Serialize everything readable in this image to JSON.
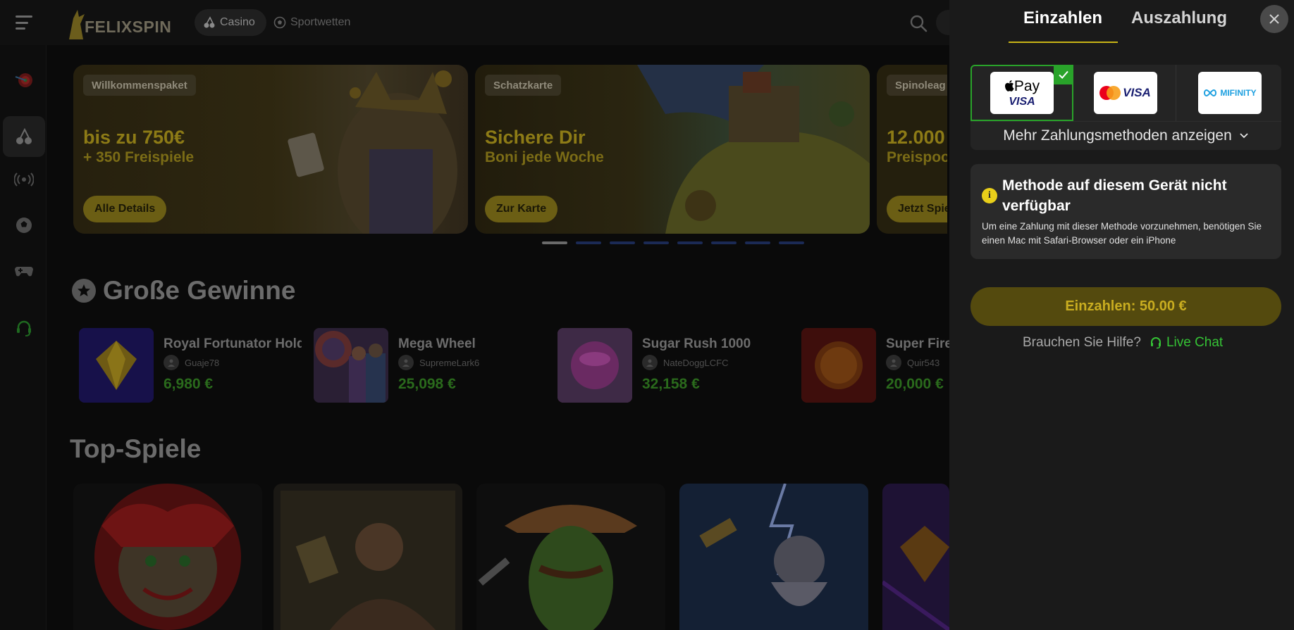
{
  "header": {
    "logo_text": "FELIXSPIN",
    "nav": {
      "casino": "Casino",
      "sports": "Sportwetten"
    }
  },
  "banners": [
    {
      "tag": "Willkommenspaket",
      "title": "bis zu 750€",
      "subtitle": "+ 350 Freispiele",
      "button": "Alle Details"
    },
    {
      "tag": "Schatzkarte",
      "title": "Sichere Dir",
      "subtitle": "Boni jede Woche",
      "button": "Zur Karte"
    },
    {
      "tag": "Spinoleag",
      "title": "12.000",
      "subtitle": "Preispoo",
      "button": "Jetzt Spie"
    }
  ],
  "carousel": {
    "count": 8,
    "active": 0
  },
  "big_wins": {
    "title": "Große Gewinne",
    "items": [
      {
        "game": "Royal Fortunator Hold",
        "user": "Guaje78",
        "amount": "6,980 €"
      },
      {
        "game": "Mega Wheel",
        "user": "SupremeLark6",
        "amount": "25,098 €"
      },
      {
        "game": "Sugar Rush 1000",
        "user": "NateDoggLCFC",
        "amount": "32,158 €"
      },
      {
        "game": "Super Fire",
        "user": "Quir543",
        "amount": "20,000 €"
      }
    ]
  },
  "top_games": {
    "title": "Top-Spiele"
  },
  "cashier": {
    "tabs": {
      "deposit": "Einzahlen",
      "payout": "Auszahlung"
    },
    "payment_methods": {
      "apple_pay": {
        "top": "Pay",
        "bottom": "VISA"
      },
      "card": {
        "label": "VISA"
      },
      "mifinity": {
        "label": "MIFINITY"
      },
      "more": "Mehr Zahlungsmethoden anzeigen"
    },
    "notice": {
      "title": "Methode auf diesem Gerät nicht verfügbar",
      "text": "Um eine Zahlung mit dieser Methode vorzunehmen, benötigen Sie einen Mac mit Safari-Browser oder ein iPhone"
    },
    "deposit_button": "Einzahlen: 50.00 €",
    "help": {
      "question": "Brauchen Sie Hilfe?",
      "live_chat": "Live Chat"
    }
  },
  "colors": {
    "accent_yellow": "#c9ad20",
    "selected_green": "#29a32a",
    "live_chat_green": "#35c335",
    "drawer_bg": "#1a1a1a"
  }
}
